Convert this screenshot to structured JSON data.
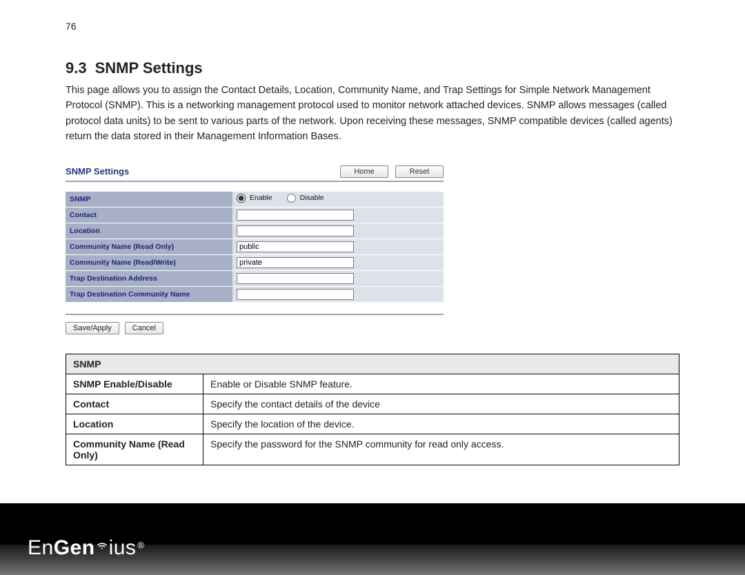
{
  "pageNumber": "76",
  "heading": {
    "number": "9.3",
    "title": "SNMP Settings"
  },
  "intro": "This page allows you to assign the Contact Details, Location, Community Name, and Trap Settings for Simple Network Management Protocol (SNMP). This is a networking management protocol used to monitor network attached devices. SNMP allows messages (called protocol data units) to be sent to various parts of the network. Upon receiving these messages, SNMP compatible devices (called agents) return the data stored in their Management Information Bases.",
  "panel": {
    "title": "SNMP Settings",
    "buttons": {
      "home": "Home",
      "reset": "Reset"
    },
    "rows": {
      "snmp": {
        "label": "SNMP",
        "enable": "Enable",
        "disable": "Disable"
      },
      "contact": {
        "label": "Contact",
        "value": ""
      },
      "location": {
        "label": "Location",
        "value": ""
      },
      "community_ro": {
        "label": "Community Name (Read Only)",
        "value": "public"
      },
      "community_rw": {
        "label": "Community Name (Read/Write)",
        "value": "private"
      },
      "trap_dest": {
        "label": "Trap Destination Address",
        "value": ""
      },
      "trap_comm": {
        "label": "Trap Destination Community Name",
        "value": ""
      }
    },
    "actions": {
      "save": "Save/Apply",
      "cancel": "Cancel"
    }
  },
  "desc": {
    "headerRow": "SNMP",
    "rows": [
      {
        "key": "SNMP Enable/Disable",
        "text": "Enable or Disable SNMP feature."
      },
      {
        "key": "Contact",
        "text": "Specify the contact details of the device"
      },
      {
        "key": "Location",
        "text": "Specify the location of the device."
      },
      {
        "key": "Community Name (Read Only)",
        "text": "Specify the password for the SNMP community for read only access."
      }
    ]
  },
  "brand": {
    "prefix": "En",
    "accent": "Gen",
    "suffix": "ius",
    "reg": "®"
  }
}
